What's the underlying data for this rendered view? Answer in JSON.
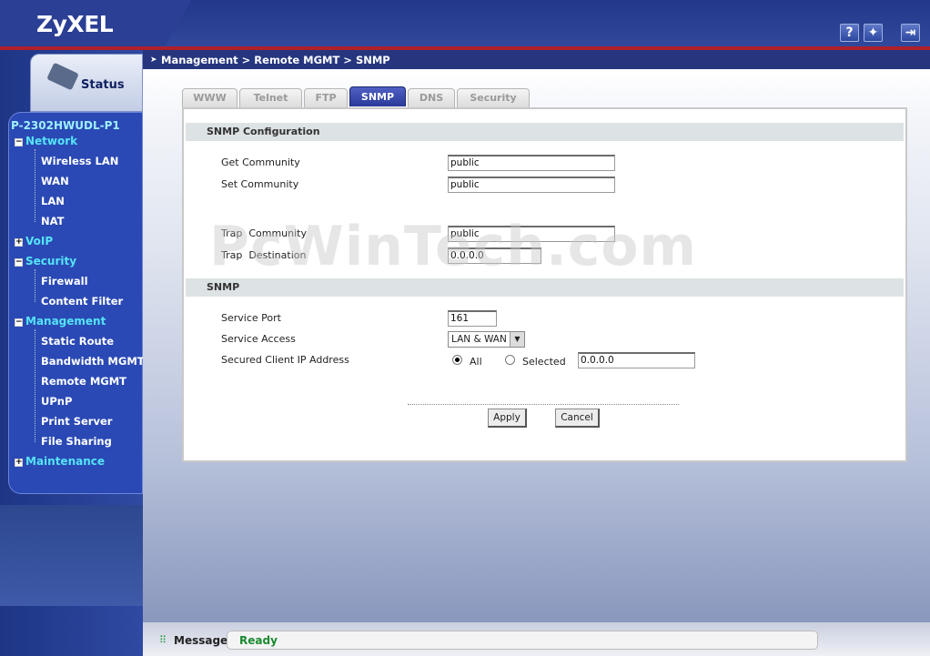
{
  "header": {
    "brand": "ZyXEL",
    "help_icon_label": "?",
    "wizard_icon_label": "✦",
    "logout_icon_label": "⇥"
  },
  "sidebar": {
    "status_tab": "Status",
    "device_name": "P-2302HWUDL-P1",
    "groups": [
      {
        "label": "Network",
        "expanded": true,
        "items": [
          "Wireless LAN",
          "WAN",
          "LAN",
          "NAT"
        ]
      },
      {
        "label": "VoIP",
        "expanded": false,
        "items": []
      },
      {
        "label": "Security",
        "expanded": true,
        "items": [
          "Firewall",
          "Content Filter"
        ]
      },
      {
        "label": "Management",
        "expanded": true,
        "items": [
          "Static Route",
          "Bandwidth MGMT",
          "Remote MGMT",
          "UPnP",
          "Print Server",
          "File Sharing"
        ]
      },
      {
        "label": "Maintenance",
        "expanded": false,
        "items": []
      }
    ]
  },
  "breadcrumb": "Management > Remote MGMT > SNMP",
  "tabs": [
    "WWW",
    "Telnet",
    "FTP",
    "SNMP",
    "DNS",
    "Security"
  ],
  "active_tab": "SNMP",
  "snmp_config": {
    "title": "SNMP Configuration",
    "get_community_label": "Get Community",
    "get_community_value": "public",
    "set_community_label": "Set Community",
    "set_community_value": "public",
    "trap_community_label": "Trap  Community",
    "trap_community_value": "public",
    "trap_destination_label": "Trap  Destination",
    "trap_destination_value": "0.0.0.0"
  },
  "snmp": {
    "title": "SNMP",
    "service_port_label": "Service Port",
    "service_port_value": "161",
    "service_access_label": "Service Access",
    "service_access_value": "LAN & WAN",
    "secured_ip_label": "Secured Client IP Address",
    "radio_all": "All",
    "radio_selected": "Selected",
    "selected_ip_value": "0.0.0.0"
  },
  "buttons": {
    "apply": "Apply",
    "cancel": "Cancel"
  },
  "watermark": "PcWinTech.com",
  "footer": {
    "label": "Message",
    "status": "Ready"
  }
}
